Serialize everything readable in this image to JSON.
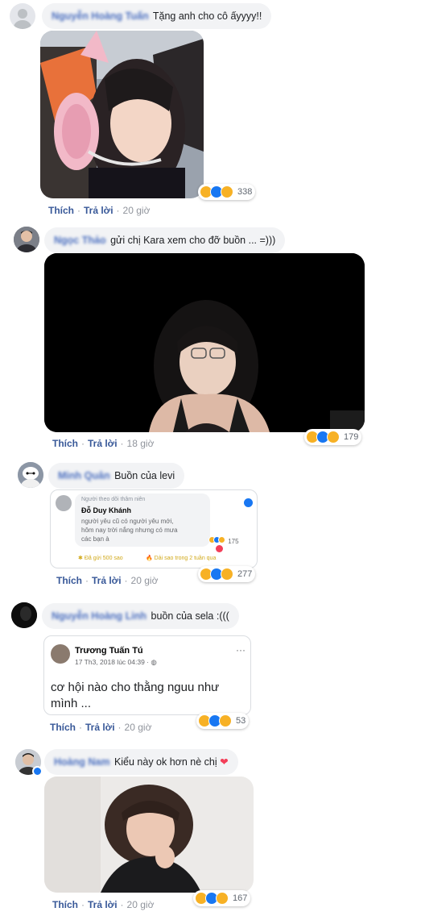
{
  "comments": [
    {
      "author": "Nguyễn Hoàng Tuấn",
      "text": "Tặng anh cho cô ấyyyy!!",
      "reactions": "338",
      "actions": {
        "like": "Thích",
        "reply": "Trả lời",
        "time": "20 giờ"
      }
    },
    {
      "author": "Ngọc Thảo",
      "text": "gửi chị Kara xem cho đỡ buồn ... =)))",
      "reactions": "179",
      "actions": {
        "like": "Thích",
        "reply": "Trả lời",
        "time": "18 giờ"
      }
    },
    {
      "author": "Minh Quân",
      "text": "Buồn của levi",
      "reactions": "277",
      "actions": {
        "like": "Thích",
        "reply": "Trả lời",
        "time": "20 giờ"
      },
      "embed": {
        "badge": "Người theo dõi thâm niên",
        "name": "Đỗ Duy Khánh",
        "line1": "người yêu cũ có người yêu mới,",
        "line2": "hôm nay trời nắng nhưng có mưa",
        "line3": "các bạn à",
        "reactions": "175",
        "star_note": "Đã gửi 500 sao",
        "fire_note": "Dải sao trong 2 tuần qua"
      }
    },
    {
      "author": "Nguyễn Hoàng Linh",
      "text": "buồn của sela :(((",
      "reactions": "53",
      "actions": {
        "like": "Thích",
        "reply": "Trả lời",
        "time": "20 giờ"
      },
      "post": {
        "name": "Trương Tuấn Tú",
        "date": "17 Th3, 2018 lúc 04:39 ·",
        "more": "···",
        "line1": "cơ hội nào cho thằng nguu như",
        "line2": "mình ..."
      }
    },
    {
      "author": "Hoàng Nam",
      "text": "Kiểu này ok hơn nè chị",
      "reactions": "167",
      "actions": {
        "like": "Thích",
        "reply": "Trả lời",
        "time": "20 giờ"
      }
    }
  ],
  "colors": {
    "link": "#385898",
    "bubble": "#f2f3f5",
    "meta": "#90949c",
    "love": "#f33e58",
    "like_blue": "#1877f2"
  }
}
